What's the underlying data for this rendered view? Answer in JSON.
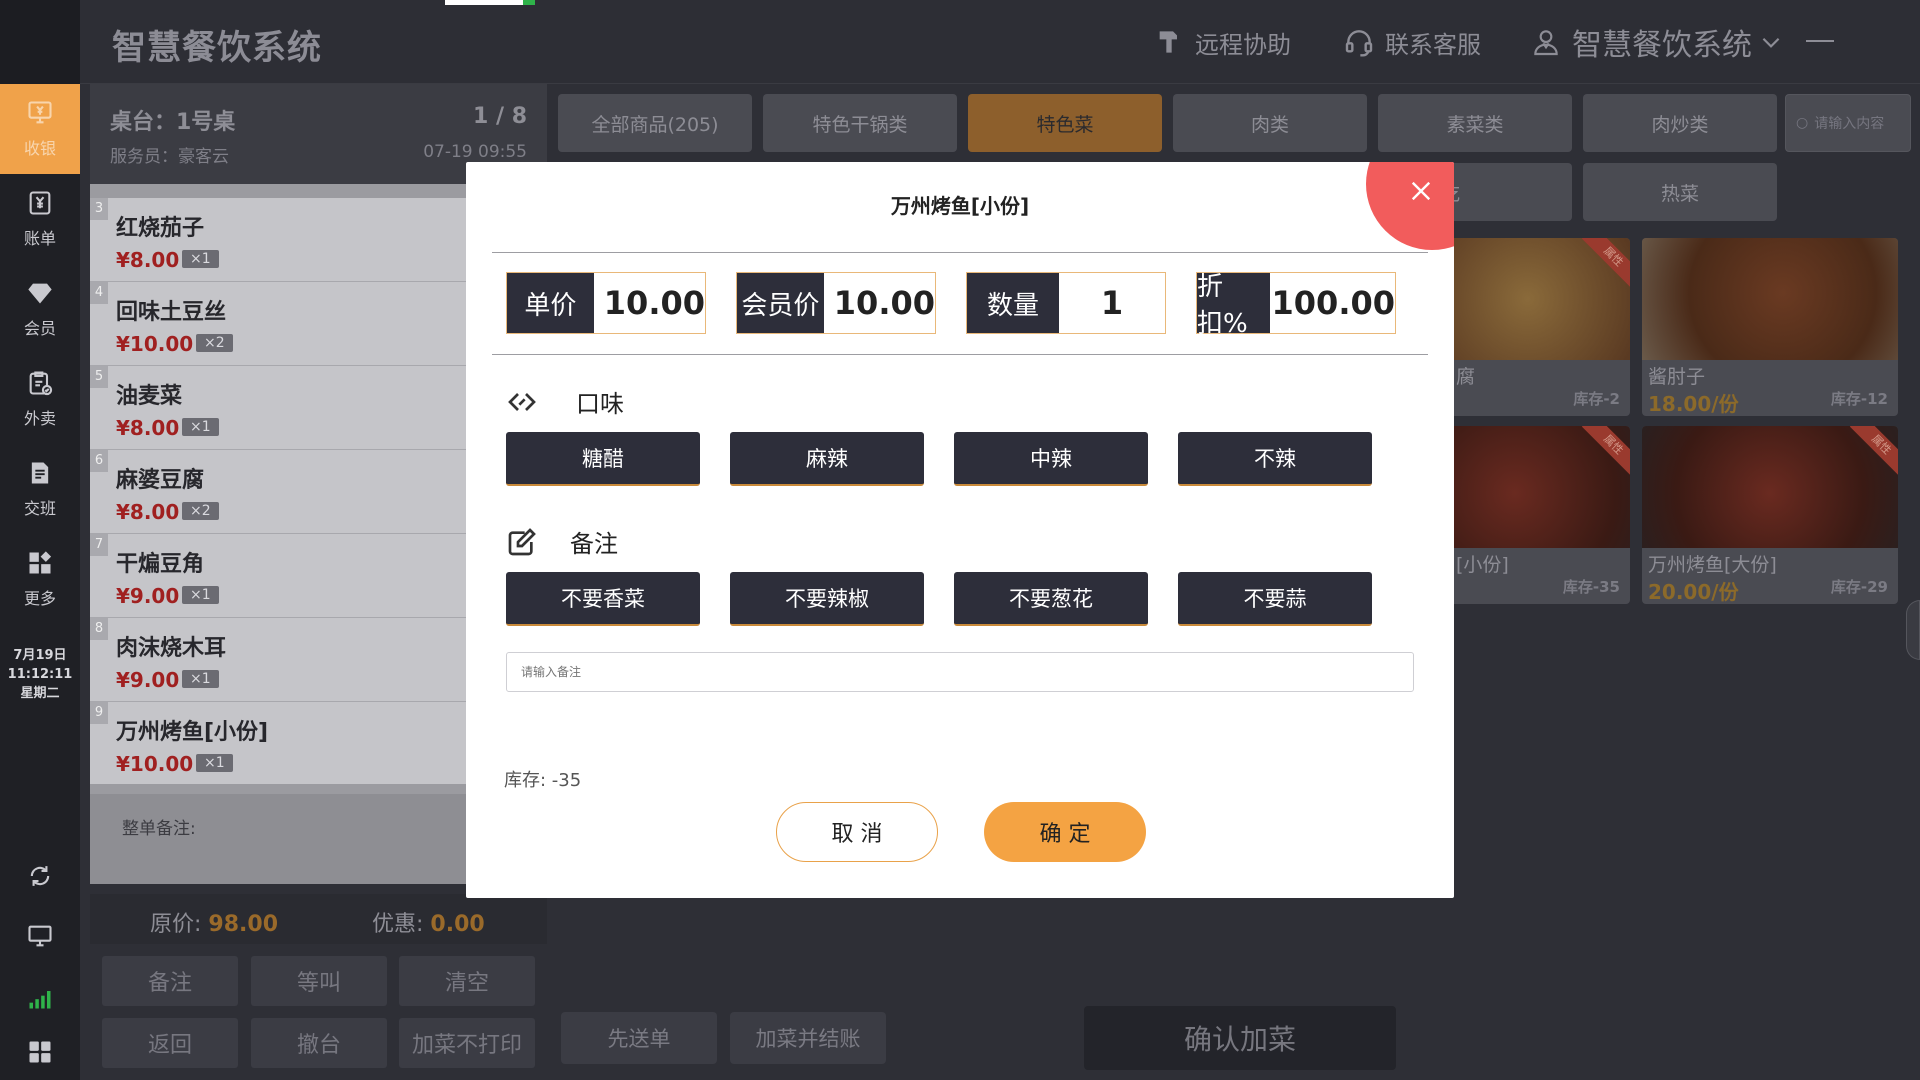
{
  "app": {
    "title": "智慧餐饮系统"
  },
  "topbar": {
    "remote": "远程协助",
    "service": "联系客服",
    "account": "智慧餐饮系统"
  },
  "nav": {
    "items": [
      {
        "label": "收银"
      },
      {
        "label": "账单"
      },
      {
        "label": "会员"
      },
      {
        "label": "外卖"
      },
      {
        "label": "交班"
      },
      {
        "label": "更多"
      }
    ],
    "date": "7月19日",
    "time": "11:12:11",
    "weekday": "星期二"
  },
  "table": {
    "title": "桌台：1号桌",
    "server": "服务员：豪客云",
    "page": "1 / 8",
    "datetime": "07-19 09:55"
  },
  "orders": [
    {
      "num": "3",
      "name": "红烧茄子",
      "price": "¥8.00",
      "qty": "×1"
    },
    {
      "num": "4",
      "name": "回味土豆丝",
      "price": "¥10.00",
      "qty": "×2"
    },
    {
      "num": "5",
      "name": "油麦菜",
      "price": "¥8.00",
      "qty": "×1"
    },
    {
      "num": "6",
      "name": "麻婆豆腐",
      "price": "¥8.00",
      "qty": "×2"
    },
    {
      "num": "7",
      "name": "干煸豆角",
      "price": "¥9.00",
      "qty": "×1"
    },
    {
      "num": "8",
      "name": "肉沫烧木耳",
      "price": "¥9.00",
      "qty": "×1"
    },
    {
      "num": "9",
      "name": "万州烤鱼[小份]",
      "price": "¥10.00",
      "qty": "×1"
    }
  ],
  "order_note_label": "整单备注:",
  "totals": {
    "orig_label": "原价:",
    "orig": "98.00",
    "disc_label": "优惠:",
    "disc": "0.00"
  },
  "actions": {
    "note": "备注",
    "wait": "等叫",
    "clear": "清空",
    "back": "返回",
    "cancel_table": "撤台",
    "add_noprint": "加菜不打印"
  },
  "categories": [
    {
      "label": "全部商品(205)"
    },
    {
      "label": "特色干锅类"
    },
    {
      "label": "特色菜"
    },
    {
      "label": "肉类"
    },
    {
      "label": "素菜类"
    },
    {
      "label": "肉炒类"
    },
    {
      "label": "小吃"
    },
    {
      "label": "热菜"
    }
  ],
  "search": {
    "placeholder": "请输入内容"
  },
  "dishes": [
    {
      "name": "腐",
      "price": "",
      "stock": "库存-2",
      "ribbon": "属性"
    },
    {
      "name": "酱肘子",
      "price": "18.00/份",
      "stock": "库存-12",
      "ribbon": ""
    },
    {
      "name": "[小份]",
      "price": "",
      "stock": "库存-35",
      "ribbon": "属性"
    },
    {
      "name": "万州烤鱼[大份]",
      "price": "20.00/份",
      "stock": "库存-29",
      "ribbon": "属性"
    }
  ],
  "bottom": {
    "send_first": "先送单",
    "add_checkout": "加菜并结账",
    "confirm_add": "确认加菜"
  },
  "modal": {
    "title": "万州烤鱼[小份]",
    "unit_price_label": "单价",
    "unit_price": "10.00",
    "member_price_label": "会员价",
    "member_price": "10.00",
    "qty_label": "数量",
    "qty": "1",
    "discount_label": "折扣%",
    "discount": "100.00",
    "flavor_title": "口味",
    "flavors": [
      "糖醋",
      "麻辣",
      "中辣",
      "不辣"
    ],
    "remark_title": "备注",
    "remarks": [
      "不要香菜",
      "不要辣椒",
      "不要葱花",
      "不要蒜"
    ],
    "note_placeholder": "请输入备注",
    "stock": "库存: -35",
    "cancel": "取 消",
    "ok": "确 定"
  }
}
